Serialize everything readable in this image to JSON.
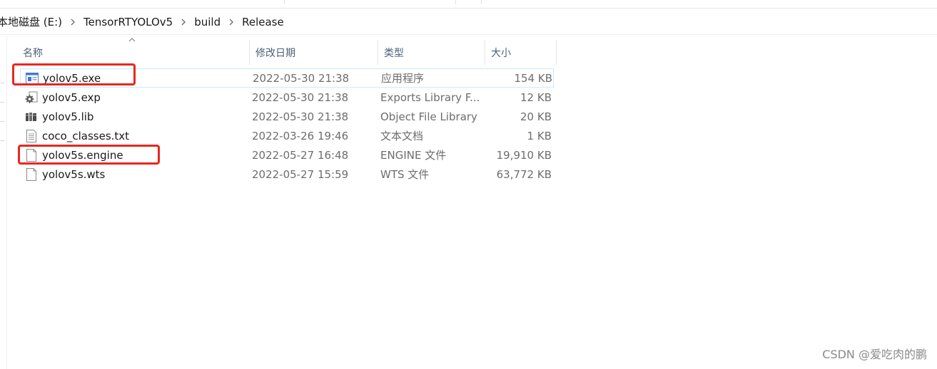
{
  "breadcrumb": {
    "items": [
      "本地磁盘 (E:)",
      "TensorRTYOLOv5",
      "build",
      "Release"
    ]
  },
  "columns": {
    "name": "名称",
    "date": "修改日期",
    "type": "类型",
    "size": "大小"
  },
  "files": [
    {
      "name": "yolov5.exe",
      "date": "2022-05-30 21:38",
      "type": "应用程序",
      "size": "154 KB",
      "icon": "exe-icon"
    },
    {
      "name": "yolov5.exp",
      "date": "2022-05-30 21:38",
      "type": "Exports Library F...",
      "size": "12 KB",
      "icon": "gear-file-icon"
    },
    {
      "name": "yolov5.lib",
      "date": "2022-05-30 21:38",
      "type": "Object File Library",
      "size": "20 KB",
      "icon": "library-icon"
    },
    {
      "name": "coco_classes.txt",
      "date": "2022-03-26 19:46",
      "type": "文本文档",
      "size": "1 KB",
      "icon": "text-file-icon"
    },
    {
      "name": "yolov5s.engine",
      "date": "2022-05-27 16:48",
      "type": "ENGINE 文件",
      "size": "19,910 KB",
      "icon": "blank-file-icon"
    },
    {
      "name": "yolov5s.wts",
      "date": "2022-05-27 15:59",
      "type": "WTS 文件",
      "size": "63,772 KB",
      "icon": "blank-file-icon"
    }
  ],
  "watermark": "CSDN @爱吃肉的鹏",
  "colors": {
    "highlight": "#e8271f",
    "selection_border": "#cde8ff",
    "header_text": "#4c607a",
    "secondary_text": "#6d6d6d"
  }
}
